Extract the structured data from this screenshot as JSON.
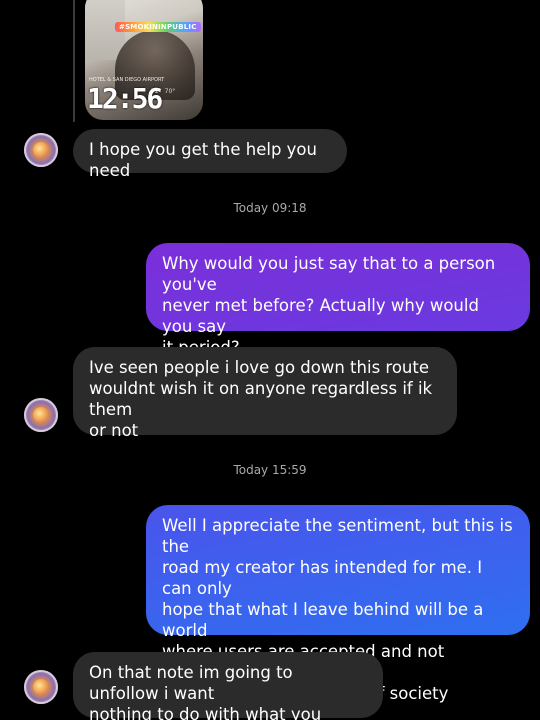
{
  "media": {
    "tag_text": "#SMOKININPUBLIC",
    "location_text": "HOTEL & SAN DIEGO AIRPORT",
    "clock_text": "12:56",
    "stats": [
      "72°",
      "70°"
    ]
  },
  "timestamps": [
    "Today 09:18",
    "Today 15:59"
  ],
  "messages": [
    {
      "direction": "incoming",
      "text": "I hope you get the help you need"
    },
    {
      "direction": "outgoing",
      "text": "Why would you just say that to a person you've\nnever met before? Actually why would you say\nit period?"
    },
    {
      "direction": "incoming",
      "text": "Ive seen people i love go down this route\nwouldnt wish it on anyone regardless if ik them\nor not"
    },
    {
      "direction": "outgoing",
      "text": "Well I appreciate the sentiment, but this is the\nroad my creator has intended for me. I can only\nhope that what I leave behind will be a world\nwhere users are accepted and not rejected or\npushed away into edges of society"
    },
    {
      "direction": "incoming",
      "text": "On that note im going to unfollow i want\nnothing to do with what you stand for"
    }
  ],
  "colors": {
    "background": "#000000",
    "incoming_bubble": "#2b2b2b",
    "outgoing_gradient_1": "#7b2fd9",
    "outgoing_gradient_2": "#2f6ff0",
    "timestamp": "#a9a9a9"
  }
}
